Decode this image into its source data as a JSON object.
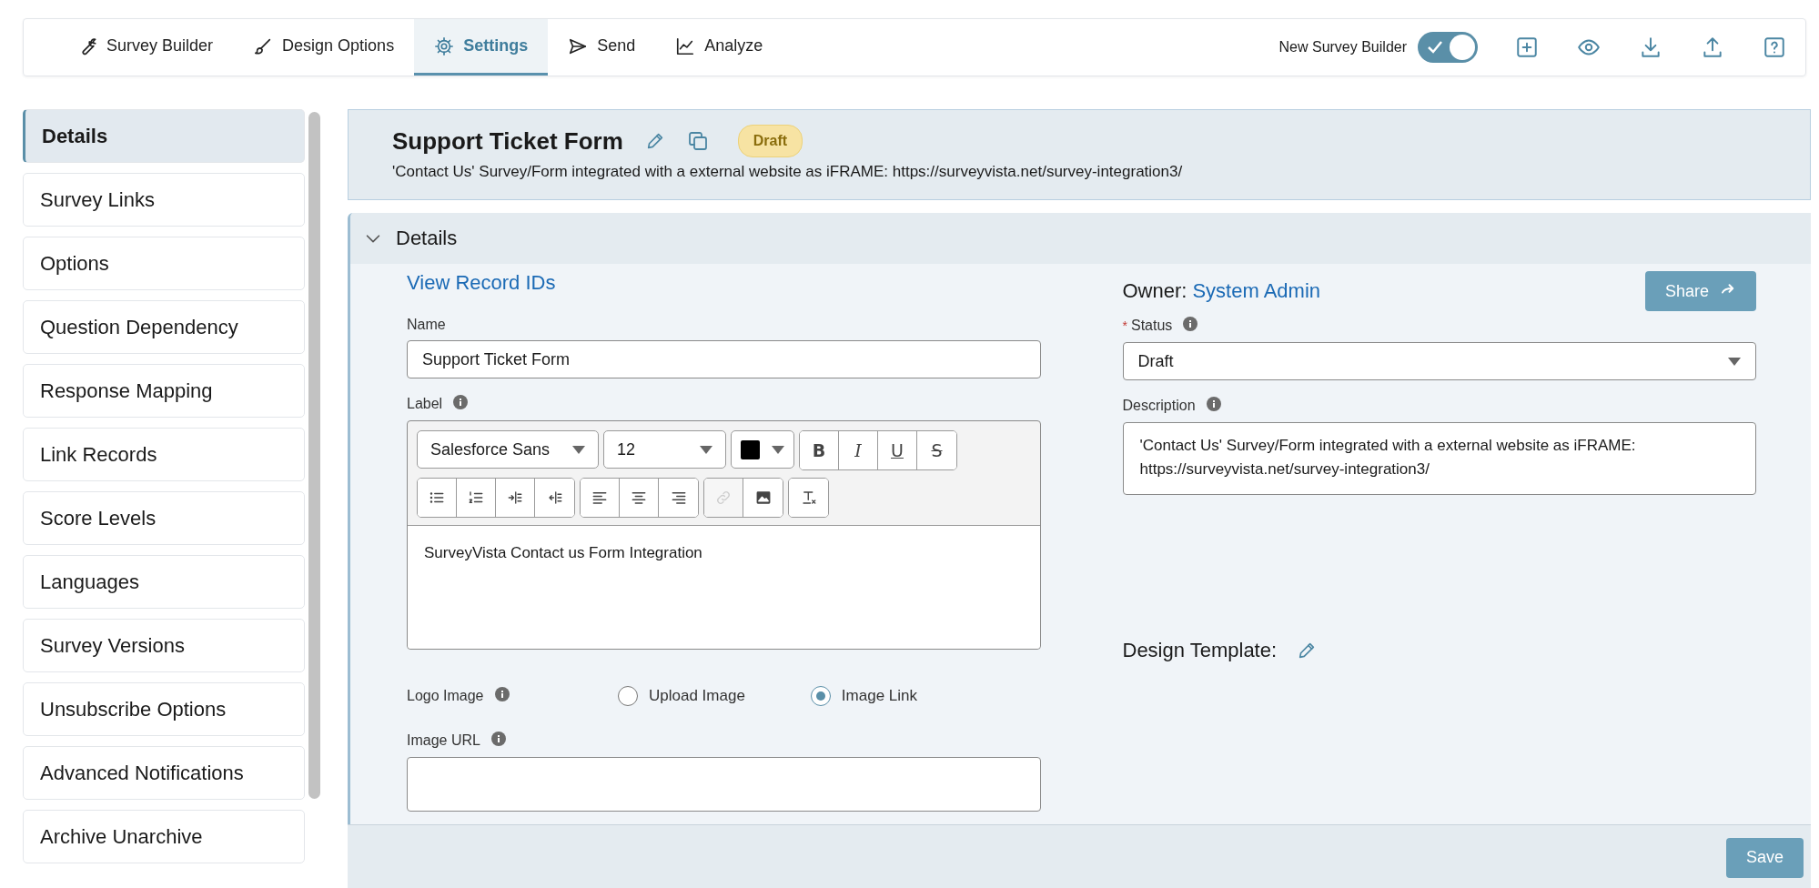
{
  "nav": {
    "tabs": [
      {
        "kind": "wrench",
        "label": "Survey Builder",
        "selected": false
      },
      {
        "kind": "brush",
        "label": "Design Options",
        "selected": false
      },
      {
        "kind": "gear",
        "label": "Settings",
        "selected": true
      },
      {
        "kind": "send",
        "label": "Send",
        "selected": false
      },
      {
        "kind": "chart",
        "label": "Analyze",
        "selected": false
      }
    ],
    "toggle": {
      "label": "New Survey Builder",
      "on": true
    },
    "actions": [
      {
        "kind": "add"
      },
      {
        "kind": "preview"
      },
      {
        "kind": "download"
      },
      {
        "kind": "upload"
      },
      {
        "kind": "help"
      }
    ]
  },
  "sidebar": {
    "items": [
      {
        "label": "Details",
        "selected": true
      },
      {
        "label": "Survey Links",
        "selected": false
      },
      {
        "label": "Options",
        "selected": false
      },
      {
        "label": "Question Dependency",
        "selected": false
      },
      {
        "label": "Response Mapping",
        "selected": false
      },
      {
        "label": "Link Records",
        "selected": false
      },
      {
        "label": "Score Levels",
        "selected": false
      },
      {
        "label": "Languages",
        "selected": false
      },
      {
        "label": "Survey Versions",
        "selected": false
      },
      {
        "label": "Unsubscribe Options",
        "selected": false
      },
      {
        "label": "Advanced Notifications",
        "selected": false
      },
      {
        "label": "Archive Unarchive",
        "selected": false
      }
    ]
  },
  "header": {
    "title": "Support Ticket Form",
    "badge": "Draft",
    "subtitle": "'Contact Us' Survey/Form integrated with a external website as iFRAME: https://surveyvista.net/survey-integration3/"
  },
  "details": {
    "title": "Details",
    "expanded": true,
    "view_record_ids": "View Record IDs",
    "name": {
      "label": "Name",
      "value": "Support Ticket Form"
    },
    "label_editor": {
      "label": "Label",
      "font": "Salesforce Sans",
      "size": "12",
      "toolbar_groups": [
        [
          {
            "kind": "bold",
            "glyph": "B",
            "disabled": false
          },
          {
            "kind": "italic",
            "glyph": "I",
            "disabled": false
          },
          {
            "kind": "underline",
            "glyph": "U",
            "disabled": false
          },
          {
            "kind": "strike",
            "glyph": "S",
            "disabled": false
          }
        ],
        [
          {
            "kind": "bullets",
            "disabled": false
          },
          {
            "kind": "numbers",
            "disabled": false
          },
          {
            "kind": "indent",
            "disabled": false
          },
          {
            "kind": "outdent",
            "disabled": false
          }
        ],
        [
          {
            "kind": "align-left",
            "disabled": false
          },
          {
            "kind": "align-center",
            "disabled": false
          },
          {
            "kind": "align-right",
            "disabled": false
          }
        ],
        [
          {
            "kind": "link",
            "disabled": true
          },
          {
            "kind": "image",
            "disabled": false
          }
        ],
        [
          {
            "kind": "clear",
            "disabled": false
          }
        ]
      ],
      "content": "SurveyVista Contact us Form Integration"
    },
    "logo_image": {
      "label": "Logo Image",
      "options": [
        {
          "label": "Upload Image",
          "selected": false
        },
        {
          "label": "Image Link",
          "selected": true
        }
      ]
    },
    "image_url": {
      "label": "Image URL"
    },
    "owner": {
      "label": "Owner:",
      "value": "System Admin"
    },
    "share_button": "Share",
    "status": {
      "required_mark": "*",
      "label": "Status",
      "value": "Draft"
    },
    "description": {
      "label": "Description",
      "value": "'Contact Us' Survey/Form integrated with a external website as iFRAME: https://surveyvista.net/survey-integration3/"
    },
    "design_template": {
      "label": "Design Template:"
    }
  },
  "footer": {
    "save_button": "Save"
  }
}
